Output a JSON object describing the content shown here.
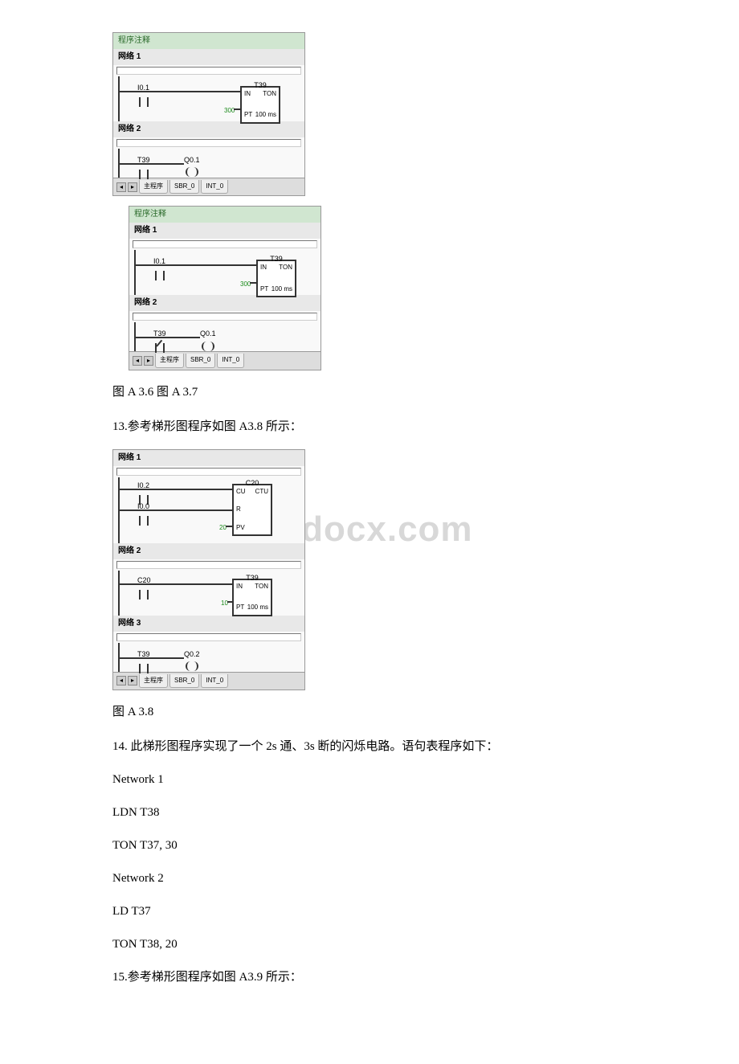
{
  "fig36": {
    "header": "程序注释",
    "net1": {
      "title": "网络 1",
      "contact": "I0.1",
      "timer": {
        "name": "T39",
        "type": "TON",
        "in": "IN",
        "pt": "PT",
        "preset": "300",
        "base": "100 ms"
      }
    },
    "net2": {
      "title": "网络 2",
      "contact": "T39",
      "coil": "Q0.1"
    },
    "tabs": {
      "main": "主程序",
      "sbr": "SBR_0",
      "int": "INT_0"
    }
  },
  "fig37": {
    "header": "程序注释",
    "net1": {
      "title": "网络 1",
      "contact": "I0.1",
      "timer": {
        "name": "T39",
        "type": "TON",
        "in": "IN",
        "pt": "PT",
        "preset": "300",
        "base": "100 ms"
      }
    },
    "net2": {
      "title": "网络 2",
      "contact": "T39",
      "coil": "Q0.1"
    },
    "tabs": {
      "main": "主程序",
      "sbr": "SBR_0",
      "int": "INT_0"
    }
  },
  "fig38": {
    "net1": {
      "title": "网络 1",
      "contact1": "I0.2",
      "contact2": "I0.0",
      "counter": {
        "name": "C20",
        "type": "CTU",
        "cu": "CU",
        "r": "R",
        "pv": "PV",
        "preset": "20"
      }
    },
    "net2": {
      "title": "网络 2",
      "contact": "C20",
      "timer": {
        "name": "T39",
        "type": "TON",
        "in": "IN",
        "pt": "PT",
        "preset": "10",
        "base": "100 ms"
      }
    },
    "net3": {
      "title": "网络 3",
      "contact": "T39",
      "coil": "Q0.2"
    },
    "tabs": {
      "main": "主程序",
      "sbr": "SBR_0",
      "int": "INT_0"
    }
  },
  "captions": {
    "c36_37": "图 A 3.6 图 A 3.7",
    "c38": "图 A 3.8"
  },
  "paragraphs": {
    "p13": "13.参考梯形图程序如图 A3.8 所示：",
    "p14": "14. 此梯形图程序实现了一个 2s 通、3s 断的闪烁电路。语句表程序如下：",
    "p15": "15.参考梯形图程序如图 A3.9 所示："
  },
  "stl": {
    "l1": "Network 1",
    "l2": "LDN T38",
    "l3": "TON T37, 30",
    "l4": "Network 2",
    "l5": "LD T37",
    "l6": "TON T38, 20"
  },
  "watermark": "www.bdocx.com"
}
